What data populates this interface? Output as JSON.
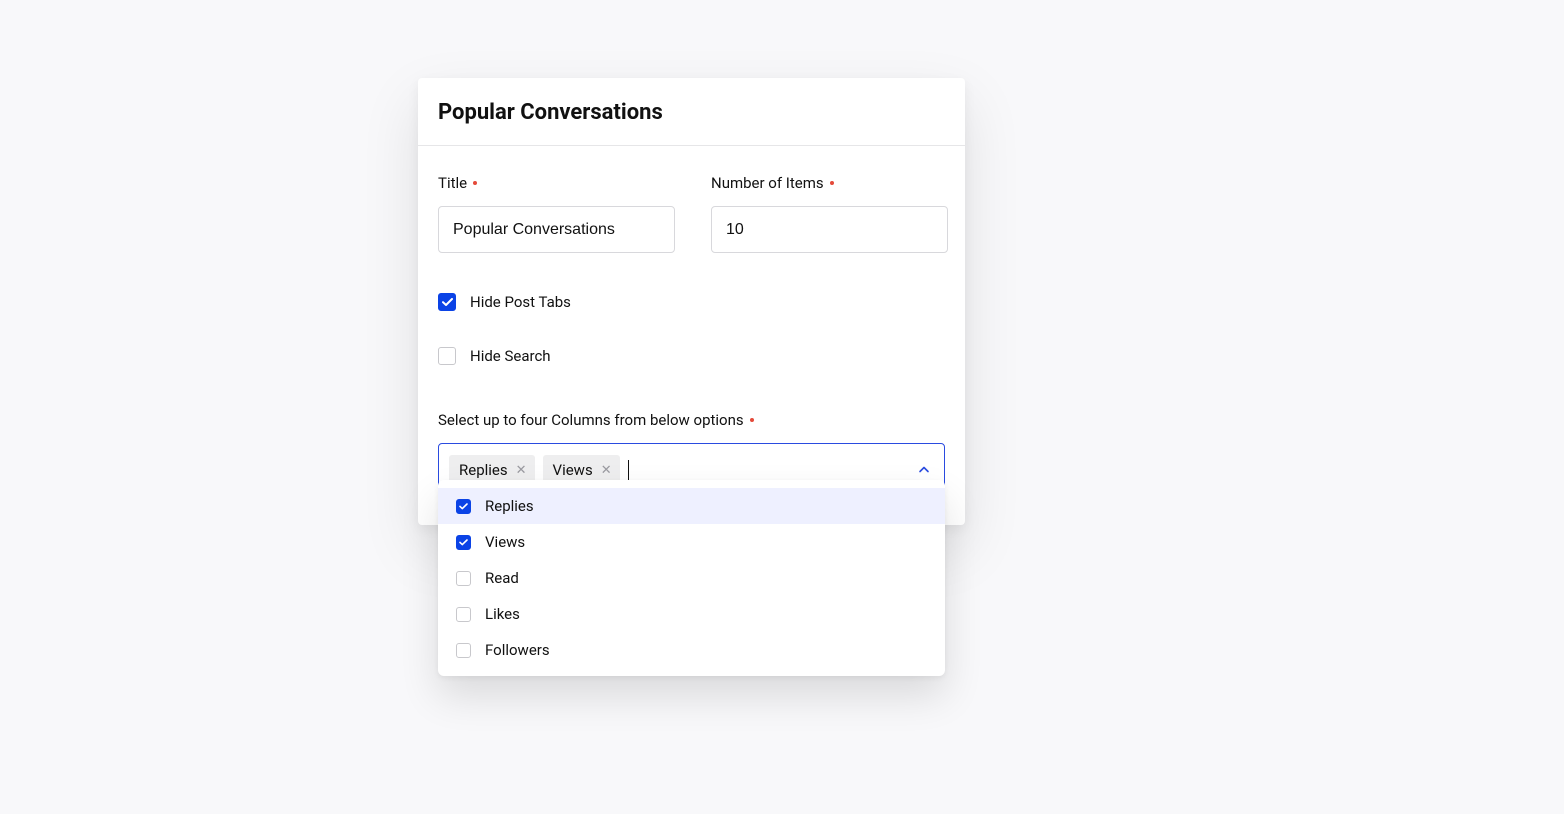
{
  "header": {
    "title": "Popular Conversations"
  },
  "fields": {
    "title": {
      "label": "Title",
      "value": "Popular Conversations",
      "required": true
    },
    "numberOfItems": {
      "label": "Number of Items",
      "value": "10",
      "required": true
    }
  },
  "checkboxes": {
    "hidePostTabs": {
      "label": "Hide Post Tabs",
      "checked": true
    },
    "hideSearch": {
      "label": "Hide Search",
      "checked": false
    }
  },
  "columns": {
    "label": "Select up to four Columns from below options",
    "required": true,
    "selected": [
      "Replies",
      "Views"
    ],
    "options": [
      {
        "label": "Replies",
        "checked": true,
        "highlighted": true
      },
      {
        "label": "Views",
        "checked": true,
        "highlighted": false
      },
      {
        "label": "Read",
        "checked": false,
        "highlighted": false
      },
      {
        "label": "Likes",
        "checked": false,
        "highlighted": false
      },
      {
        "label": "Followers",
        "checked": false,
        "highlighted": false
      }
    ]
  }
}
